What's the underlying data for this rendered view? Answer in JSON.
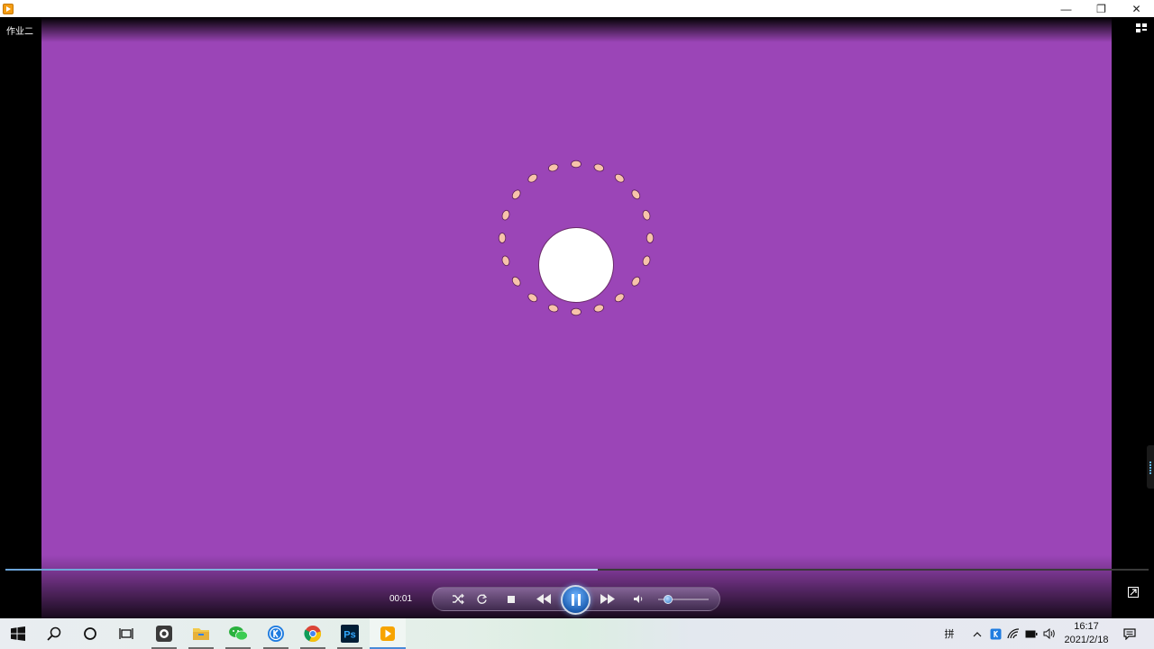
{
  "window": {
    "controls": {
      "minimize": "—",
      "restore": "❐",
      "close": "✕"
    }
  },
  "player": {
    "title": "作业二",
    "time": "00:01",
    "progress_fraction": 0.518,
    "volume_fraction": 0.2,
    "colors": {
      "background": "#9b45b7",
      "ring_dot": "#f7c3aa",
      "center": "#ffffff"
    },
    "icons": [
      "layout-icon",
      "shuffle-icon",
      "repeat-icon",
      "stop-icon",
      "rewind-icon",
      "pause-icon",
      "fast-forward-icon",
      "volume-icon",
      "expand-icon"
    ]
  },
  "taskbar": {
    "ime": "拼",
    "time": "16:17",
    "date": "2021/2/18",
    "apps": [
      "windows-start-icon",
      "search-icon",
      "cortana-icon",
      "task-view-icon",
      "camera-app-icon",
      "file-explorer-icon",
      "wechat-icon",
      "kugou-icon",
      "chrome-icon",
      "photoshop-icon",
      "video-player-icon"
    ],
    "photoshop_label": "Ps"
  }
}
